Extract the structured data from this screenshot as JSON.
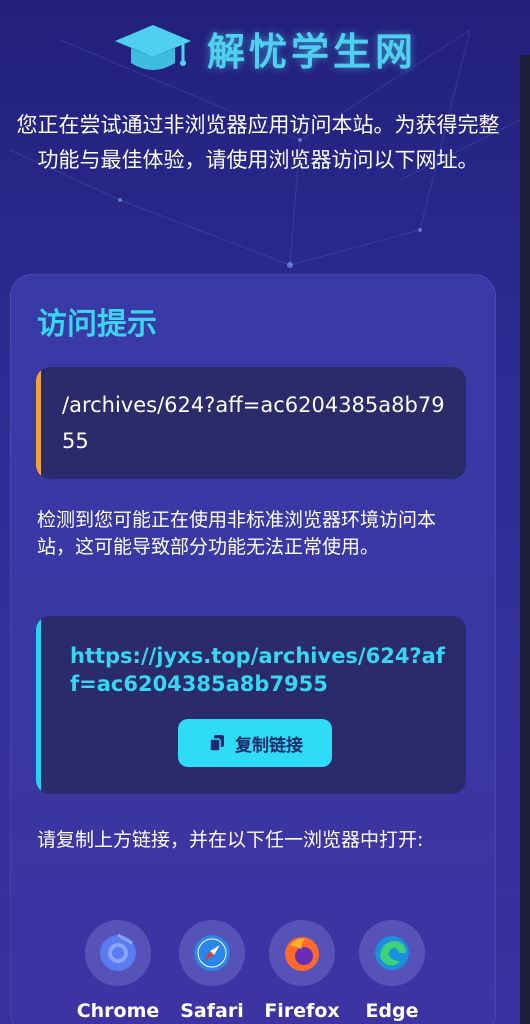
{
  "site": {
    "title": "解忧学生网",
    "logo_icon": "graduation-cap-icon"
  },
  "intro_text": "您正在尝试通过非浏览器应用访问本站。为获得完整功能与最佳体验，请使用浏览器访问以下网址。",
  "card": {
    "title": "访问提示",
    "path": "/archives/624?aff=ac6204385a8b7955",
    "warning": "检测到您可能正在使用非标准浏览器环境访问本站，这可能导致部分功能无法正常使用。",
    "url": "https://jyxs.top/archives/624?aff=ac6204385a8b7955",
    "copy_label": "复制链接",
    "copy_icon": "copy-icon",
    "instruction": "请复制上方链接，并在以下任一浏览器中打开:"
  },
  "browsers": [
    {
      "name": "Chrome",
      "icon": "chrome-icon"
    },
    {
      "name": "Safari",
      "icon": "safari-icon"
    },
    {
      "name": "Firefox",
      "icon": "firefox-icon"
    },
    {
      "name": "Edge",
      "icon": "edge-icon"
    }
  ],
  "colors": {
    "accent": "#39d6f2",
    "path_bar": "#f0a33a",
    "url_bar": "#27d3f0",
    "background": "#2b2c93"
  }
}
